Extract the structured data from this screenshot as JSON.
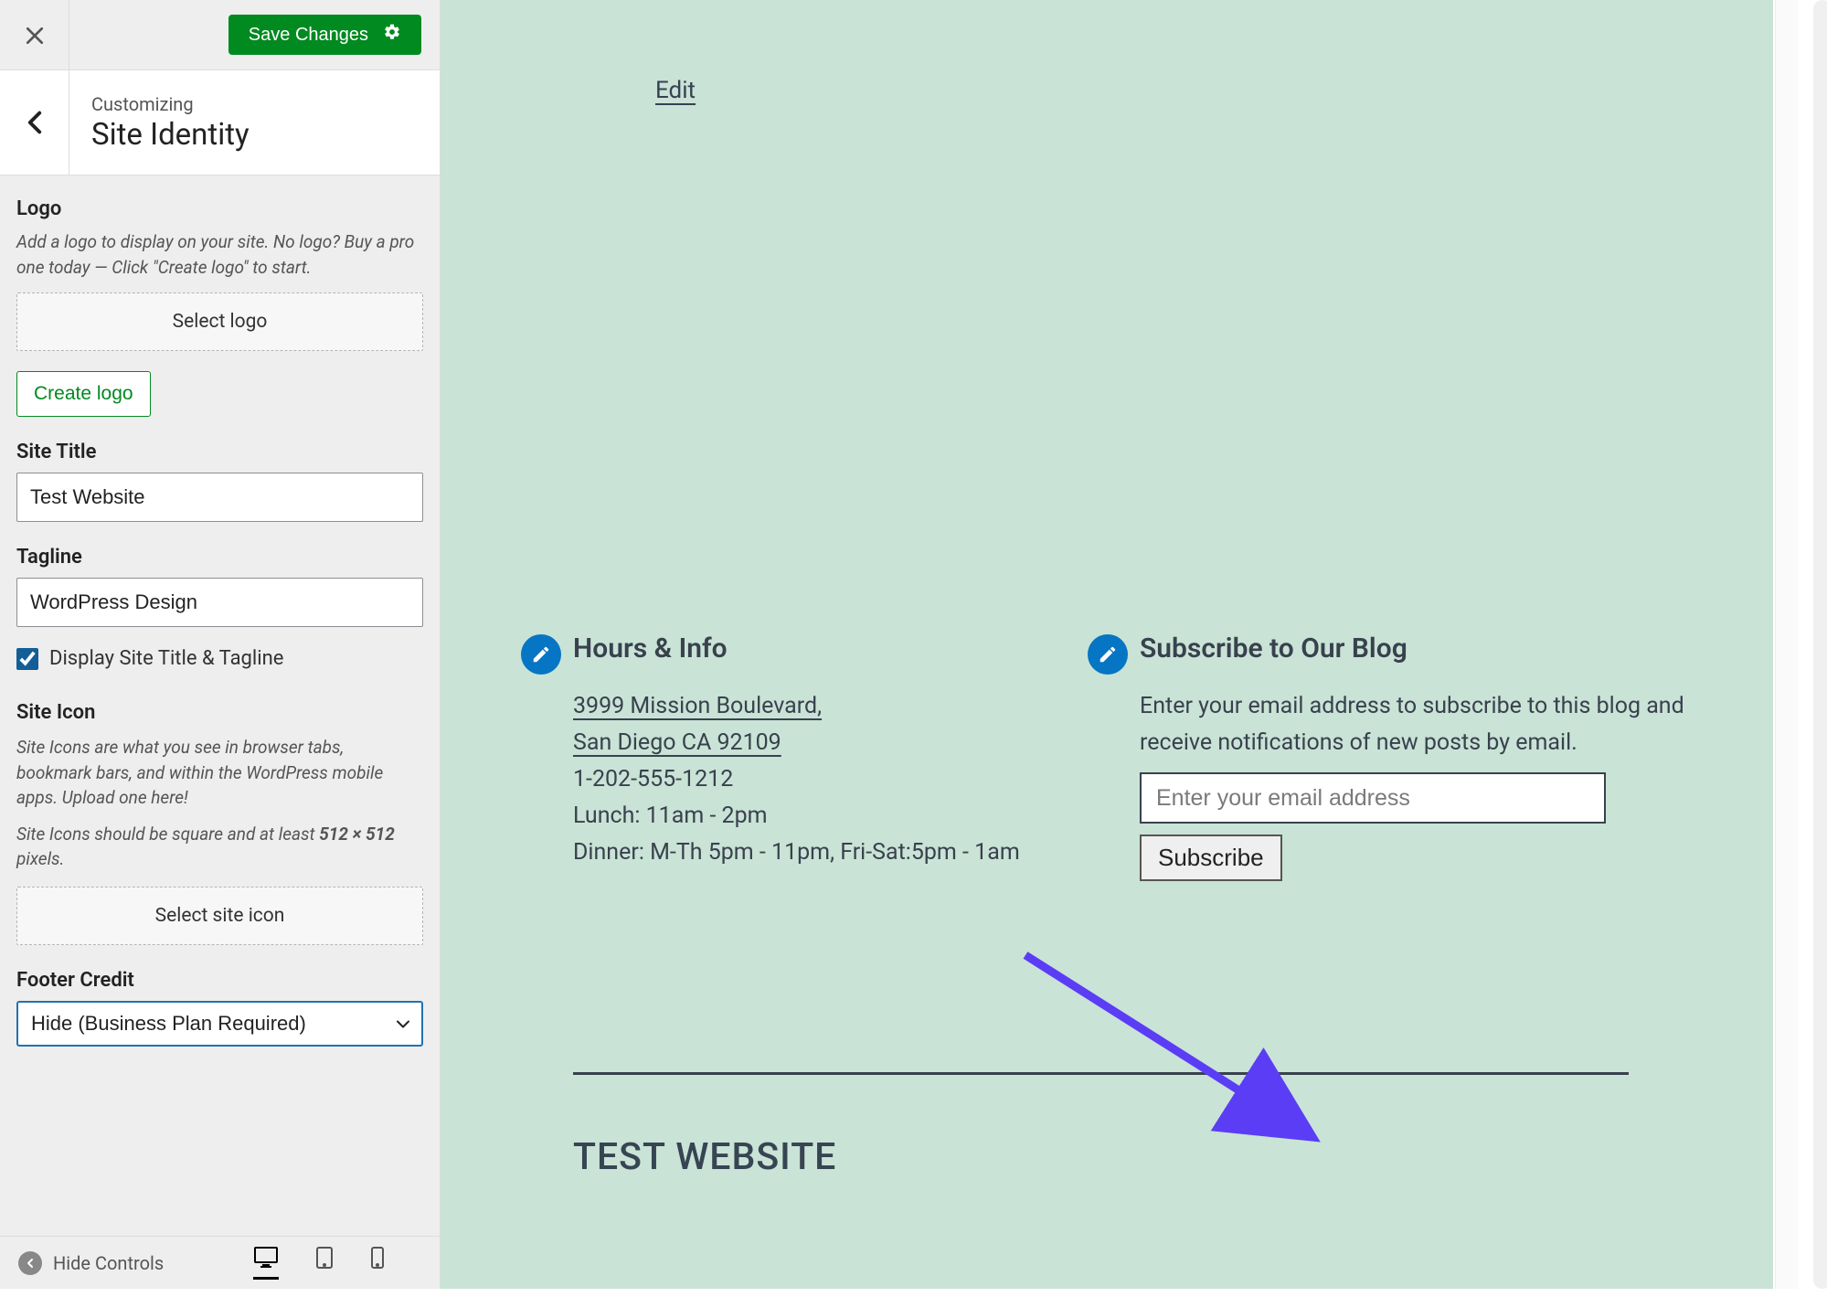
{
  "sidebar": {
    "save_label": "Save Changes",
    "customizing_label": "Customizing",
    "panel_title": "Site Identity",
    "logo": {
      "heading": "Logo",
      "desc": "Add a logo to display on your site. No logo? Buy a pro one today — Click \"Create logo\" to start.",
      "select_label": "Select logo",
      "create_label": "Create logo"
    },
    "site_title": {
      "label": "Site Title",
      "value": "Test Website"
    },
    "tagline": {
      "label": "Tagline",
      "value": "WordPress Design"
    },
    "display_checkbox": {
      "checked": true,
      "label": "Display Site Title & Tagline"
    },
    "site_icon": {
      "heading": "Site Icon",
      "desc1": "Site Icons are what you see in browser tabs, bookmark bars, and within the WordPress mobile apps. Upload one here!",
      "desc2_pre": "Site Icons should be square and at least ",
      "desc2_strong": "512 × 512",
      "desc2_post": " pixels.",
      "select_label": "Select site icon"
    },
    "footer_credit": {
      "label": "Footer Credit",
      "selected": "Hide (Business Plan Required)"
    },
    "hide_controls": "Hide Controls"
  },
  "preview": {
    "edit_link": "Edit",
    "hours": {
      "title": "Hours & Info",
      "address_line1": "3999 Mission Boulevard,",
      "address_line2": "San Diego CA 92109",
      "phone": "1-202-555-1212",
      "lunch": "Lunch: 11am - 2pm",
      "dinner": "Dinner: M-Th 5pm - 11pm, Fri-Sat:5pm - 1am"
    },
    "subscribe": {
      "title": "Subscribe to Our Blog",
      "desc": "Enter your email address to subscribe to this blog and receive notifications of new posts by email.",
      "placeholder": "Enter your email address",
      "button": "Subscribe"
    },
    "site_brand": "TEST WEBSITE"
  }
}
